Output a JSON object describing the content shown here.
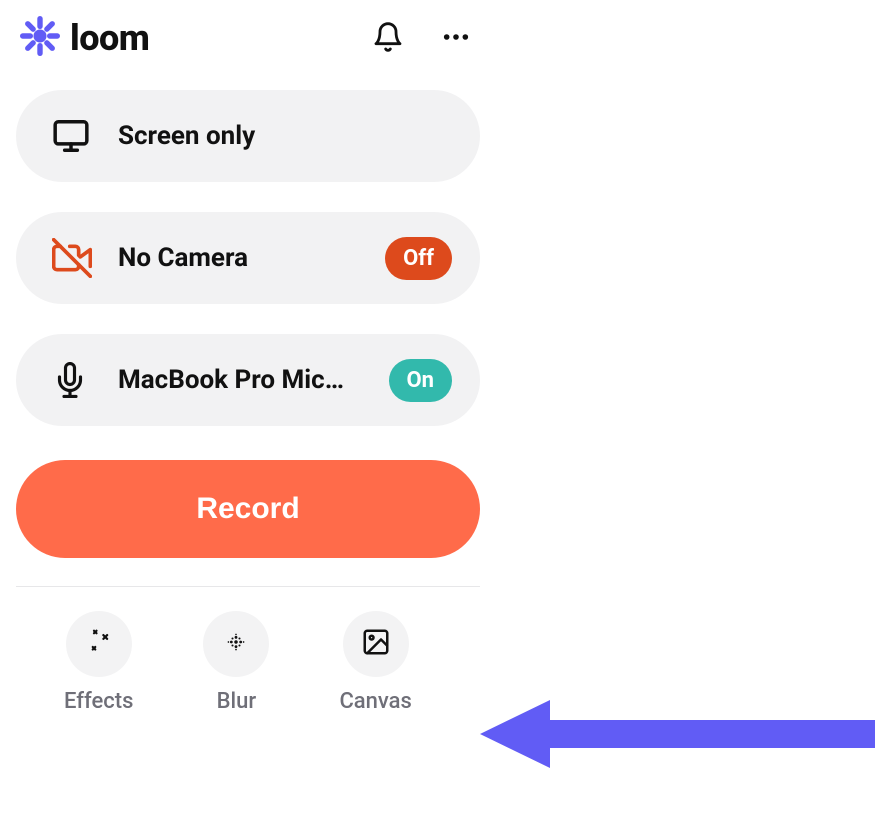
{
  "brand": {
    "name": "loom"
  },
  "options": {
    "screen": {
      "label": "Screen only"
    },
    "camera": {
      "label": "No Camera",
      "status": "Off"
    },
    "mic": {
      "label": "MacBook Pro Mic…",
      "status": "On"
    }
  },
  "record": {
    "label": "Record"
  },
  "tools": {
    "effects": {
      "label": "Effects"
    },
    "blur": {
      "label": "Blur"
    },
    "canvas": {
      "label": "Canvas"
    }
  }
}
